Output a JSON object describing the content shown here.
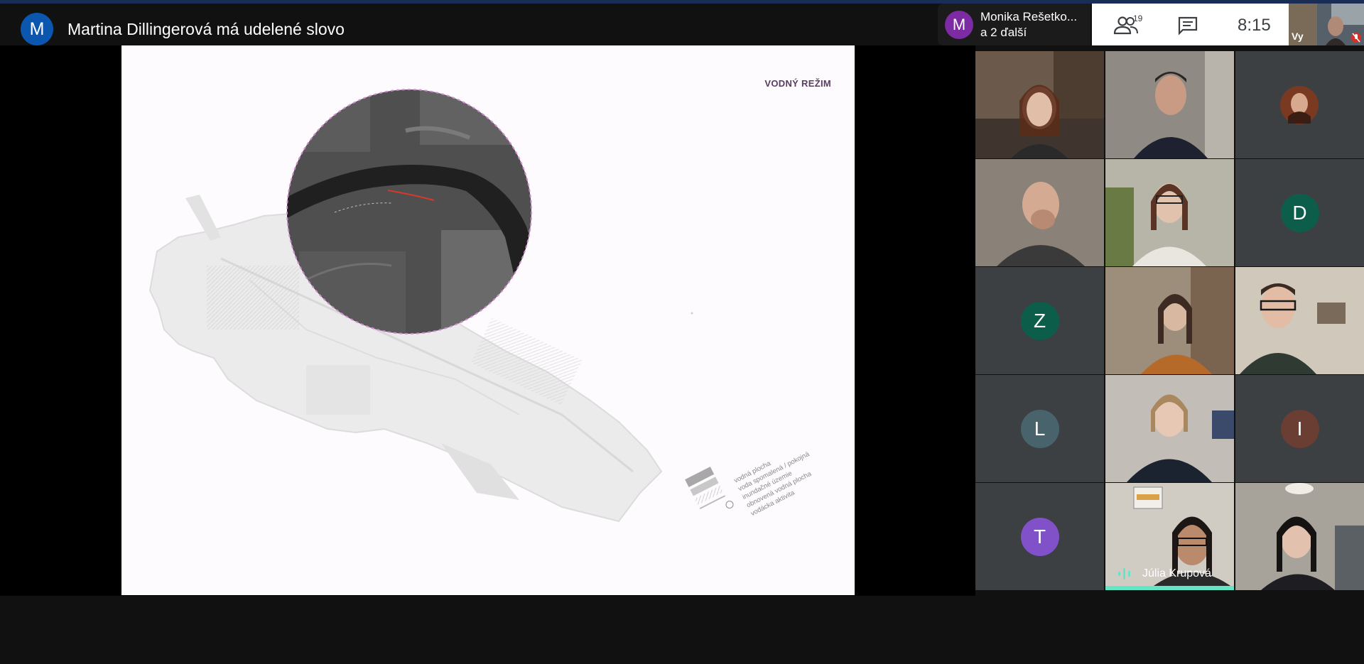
{
  "header": {
    "presenter_initial": "M",
    "presenter_title": "Martina Dillingerová má udelené slovo"
  },
  "notification": {
    "initial": "M",
    "name": "Monika Rešetko...",
    "subtitle": "a 2 ďalší"
  },
  "toolbar": {
    "people_count": "19",
    "time": "8:15"
  },
  "self_view": {
    "label": "Vy"
  },
  "slide": {
    "heading": "VODNÝ REŽIM",
    "legend": [
      "vodná plocha",
      "voda spomalená / pokojná",
      "inundačné územie",
      "obnovená vodná plocha",
      "vodácka aktivita"
    ]
  },
  "participants": [
    {
      "type": "video",
      "tone": "#6b5a4c"
    },
    {
      "type": "video",
      "tone": "#7d776e"
    },
    {
      "type": "avatar-photo",
      "tone": "#7a3a22"
    },
    {
      "type": "video",
      "tone": "#6e6861"
    },
    {
      "type": "video",
      "tone": "#8a8878"
    },
    {
      "type": "initial",
      "initial": "D",
      "color": "#0c5e4a"
    },
    {
      "type": "initial",
      "initial": "Z",
      "color": "#0c5e4a"
    },
    {
      "type": "video",
      "tone": "#8b7150"
    },
    {
      "type": "video",
      "tone": "#7c7466"
    },
    {
      "type": "initial",
      "initial": "L",
      "color": "#48636c"
    },
    {
      "type": "video",
      "tone": "#5d5a58"
    },
    {
      "type": "initial",
      "initial": "I",
      "color": "#6a3e33"
    },
    {
      "type": "initial",
      "initial": "T",
      "color": "#8151c9"
    },
    {
      "type": "video-speaking",
      "tone": "#4a4744",
      "name": "Júlia Krupová"
    },
    {
      "type": "video",
      "tone": "#6b6864"
    }
  ],
  "colors": {
    "background": "#111111",
    "speaking_highlight": "#63e6c6",
    "presenter_avatar": "#0b57b0"
  }
}
